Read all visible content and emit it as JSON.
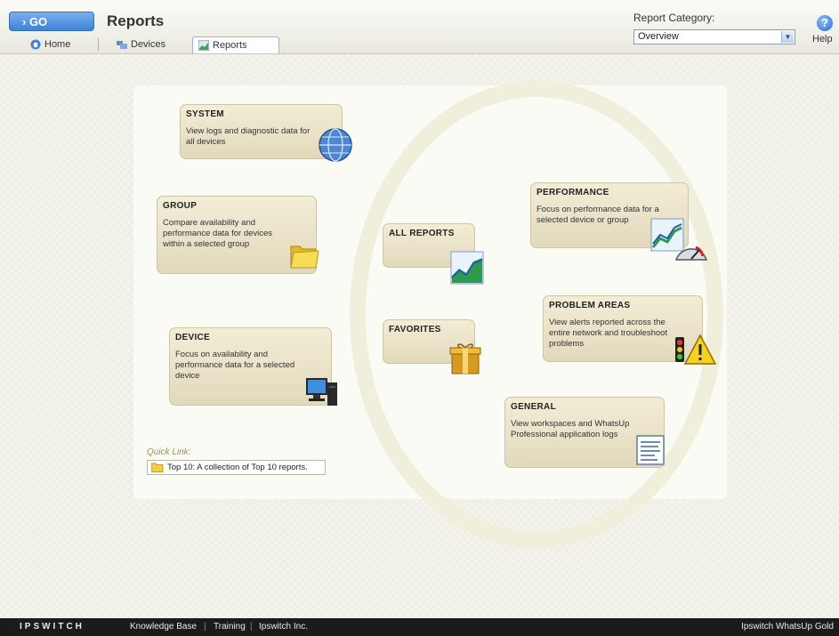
{
  "header": {
    "go_label": "› GO",
    "title": "Reports",
    "tabs": [
      {
        "label": "Home"
      },
      {
        "label": "Devices"
      },
      {
        "label": "Reports"
      }
    ],
    "report_category_label": "Report Category:",
    "report_category_value": "Overview",
    "help_label": "Help"
  },
  "cards": {
    "system": {
      "title": "SYSTEM",
      "desc": "View logs and diagnostic data for all devices",
      "icon": "globe-icon"
    },
    "group": {
      "title": "GROUP",
      "desc": "Compare availability and performance data for devices within a selected group",
      "icon": "folder-icon"
    },
    "device": {
      "title": "DEVICE",
      "desc": "Focus on availability and performance data for a selected device",
      "icon": "computer-icon"
    },
    "all_reports": {
      "title": "ALL REPORTS",
      "icon": "chart-icon"
    },
    "favorites": {
      "title": "FAVORITES",
      "icon": "gift-box-icon"
    },
    "performance": {
      "title": "PERFORMANCE",
      "desc": "Focus on performance data for a selected device or group",
      "icon": "gauge-icon"
    },
    "problem_areas": {
      "title": "PROBLEM AREAS",
      "desc": "View alerts reported across the entire network and troubleshoot problems",
      "icon": "warning-icon"
    },
    "general": {
      "title": "GENERAL",
      "desc": "View workspaces and WhatsUp Professional application logs",
      "icon": "document-icon"
    }
  },
  "quick_link": {
    "label": "Quick Link:",
    "item": "Top 10: A collection of Top 10 reports."
  },
  "footer": {
    "brand": "IPSWITCH",
    "links": [
      "Knowledge Base",
      "Training",
      "Ipswitch Inc."
    ],
    "separator": "|",
    "product": "Ipswitch WhatsUp Gold"
  },
  "colors": {
    "go_button": "#3d82d6",
    "card_bg": "#e9e2c8",
    "footer_bg": "#1b1b1b"
  }
}
